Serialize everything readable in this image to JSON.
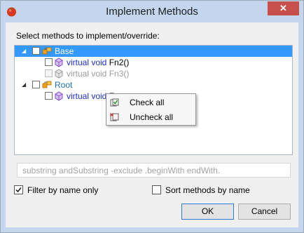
{
  "window": {
    "title": "Implement Methods",
    "close_glyph": "✕"
  },
  "prompt": "Select methods to implement/override:",
  "tree": {
    "rows": [
      {
        "kind": "class",
        "label": "Base",
        "selected": true
      },
      {
        "kind": "method",
        "modifier": "virtual void",
        "name": "Fn2()",
        "enabled": true
      },
      {
        "kind": "method",
        "modifier": "virtual void",
        "name": "Fn3()",
        "enabled": false
      },
      {
        "kind": "class",
        "label": "Root",
        "selected": false
      },
      {
        "kind": "method",
        "modifier": "virtual void",
        "name": "F",
        "enabled": true
      }
    ]
  },
  "context_menu": {
    "items": [
      {
        "label": "Check all",
        "icon": "check-all-icon"
      },
      {
        "label": "Uncheck all",
        "icon": "uncheck-all-icon"
      }
    ]
  },
  "filter": {
    "placeholder": "substring andSubstring -exclude .beginWith endWith."
  },
  "options": {
    "filter_by_name": {
      "label": "Filter by name only",
      "checked": true
    },
    "sort_methods": {
      "label": "Sort methods by name",
      "checked": false
    }
  },
  "buttons": {
    "ok": "OK",
    "cancel": "Cancel"
  },
  "colors": {
    "selection": "#3399ff",
    "title_bar": "#c3d6ee",
    "close": "#c7504a"
  }
}
